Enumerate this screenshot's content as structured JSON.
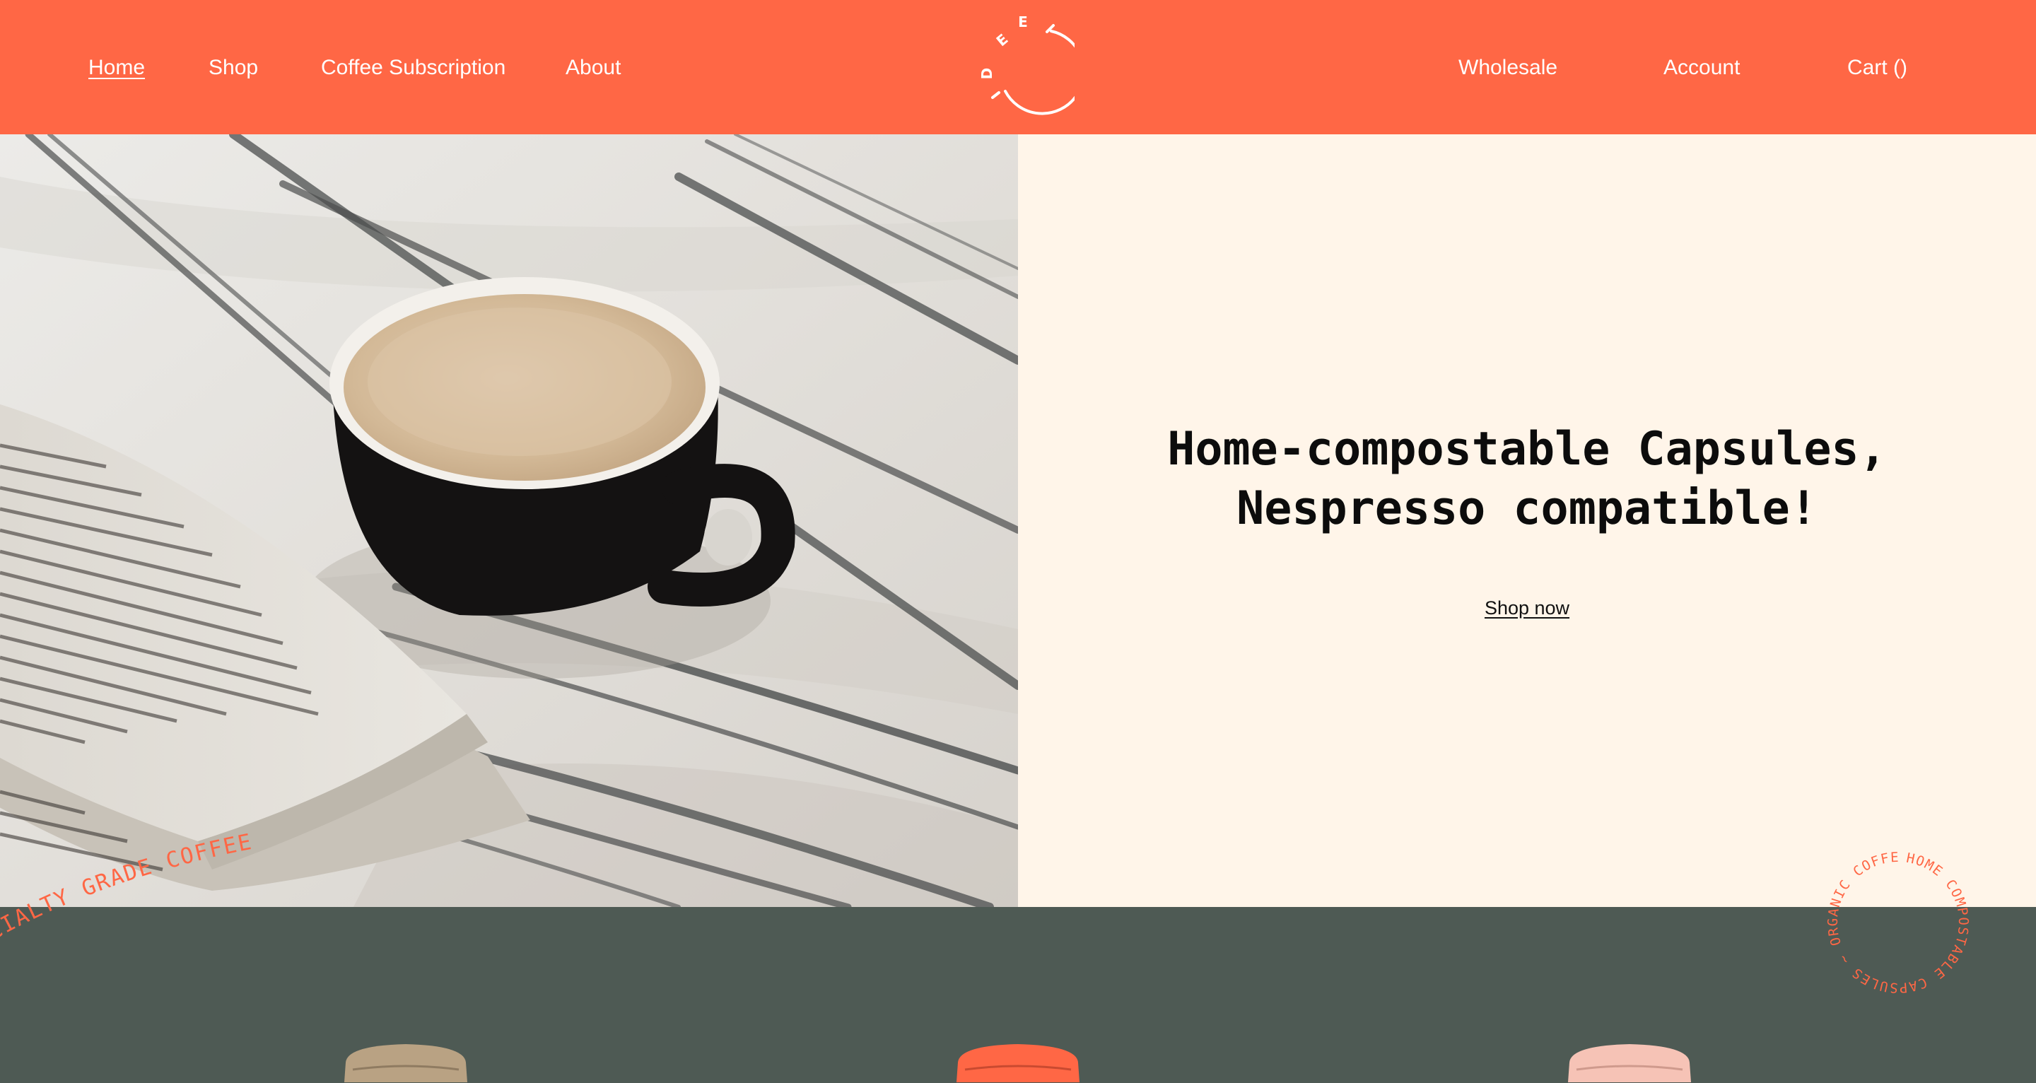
{
  "nav": {
    "left": [
      {
        "label": "Home",
        "active": true
      },
      {
        "label": "Shop"
      },
      {
        "label": "Coffee Subscription"
      },
      {
        "label": "About"
      }
    ],
    "right": [
      {
        "label": "Wholesale"
      },
      {
        "label": "Account"
      },
      {
        "label": "Cart ()"
      }
    ]
  },
  "logo": {
    "letters": [
      "D",
      "E",
      "E"
    ]
  },
  "hero": {
    "title_line1": "Home-compostable Capsules,",
    "title_line2": "Nespresso compatible!",
    "cta": "Shop now"
  },
  "badges": {
    "specialty": "CIALTY GRADE COFFEE",
    "circle": "HOME COMPOSTABLE CAPSULES ~ ORGANIC COFFEE ~ "
  },
  "capsules": [
    {
      "name": "capsule-tan",
      "color": "#b9a283"
    },
    {
      "name": "capsule-orange",
      "color": "#ff6745"
    },
    {
      "name": "capsule-pink",
      "color": "#f6c3b6"
    }
  ],
  "colors": {
    "brand_orange": "#ff6745",
    "cream": "#fff5e9",
    "band_green": "#4e5a54"
  }
}
